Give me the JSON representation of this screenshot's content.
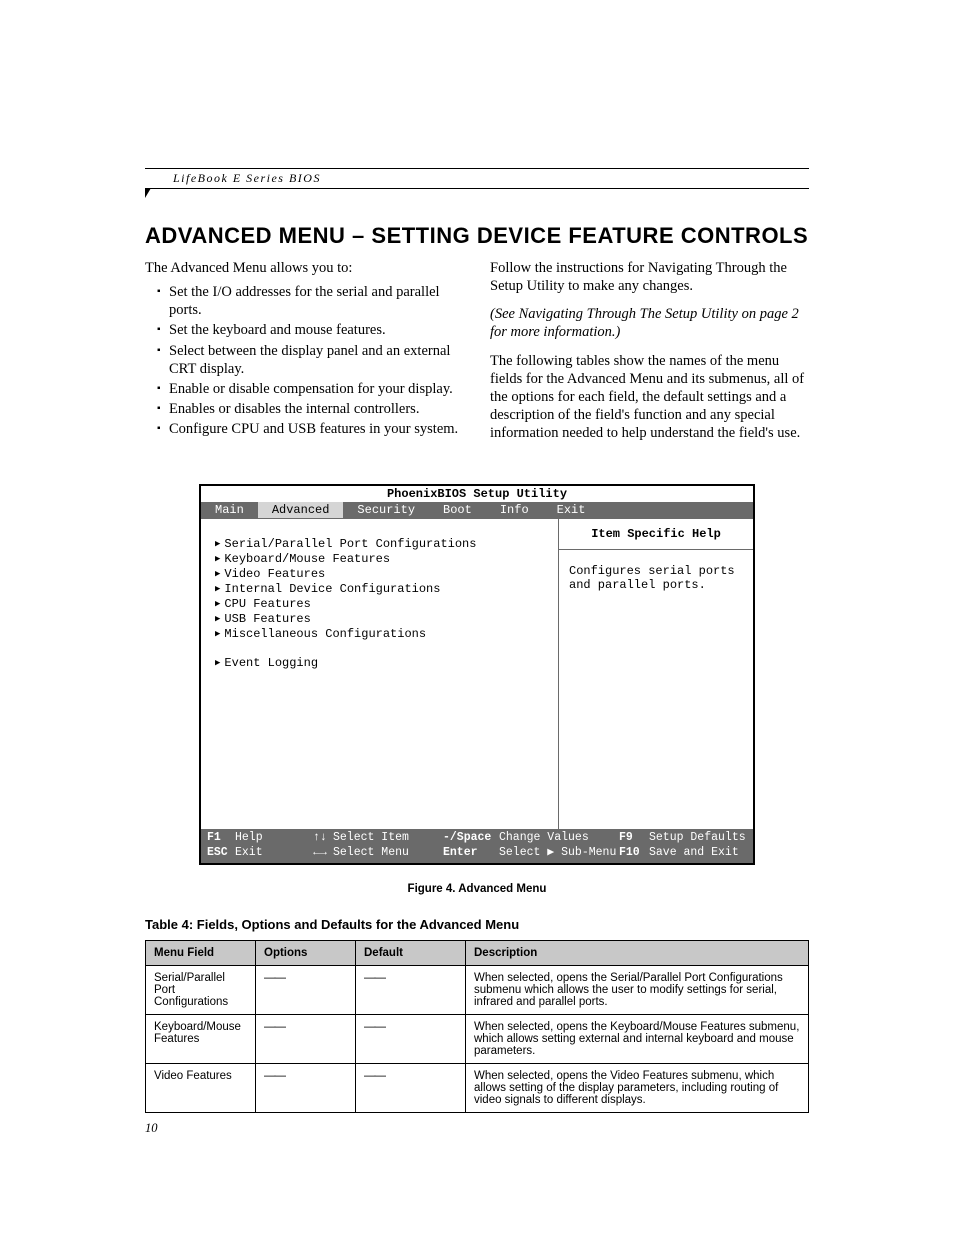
{
  "header": {
    "section_label": "LifeBook E Series BIOS"
  },
  "title": "ADVANCED MENU – SETTING DEVICE FEATURE CONTROLS",
  "left_col": {
    "intro": "The Advanced Menu allows you to:",
    "bullets": [
      "Set the I/O addresses for the serial and parallel ports.",
      "Set the keyboard and mouse features.",
      "Select between the display panel and an external CRT display.",
      "Enable or disable compensation for your display.",
      "Enables or disables the internal controllers.",
      "Configure CPU and USB features in your system."
    ]
  },
  "right_col": {
    "p1": "Follow the instructions for Navigating Through the Setup Utility to make any changes.",
    "p2": "(See Navigating Through The Setup Utility on page 2 for more information.)",
    "p3": "The following tables show the names of the menu fields for the Advanced Menu and its submenus, all of the options for each field, the default settings and a description of the field's function and any special information needed to help understand the field's use."
  },
  "bios": {
    "title": "PhoenixBIOS Setup Utility",
    "tabs": [
      "Main",
      "Advanced",
      "Security",
      "Boot",
      "Info",
      "Exit"
    ],
    "active_tab": "Advanced",
    "items": [
      "Serial/Parallel Port Configurations",
      "Keyboard/Mouse Features",
      "Video Features",
      "Internal Device Configurations",
      "CPU Features",
      "USB Features",
      "Miscellaneous Configurations"
    ],
    "items2": [
      "Event Logging"
    ],
    "help_title": "Item Specific Help",
    "help_text": "Configures serial ports and parallel ports.",
    "footer": {
      "f1": "F1",
      "help": "Help",
      "esc": "ESC",
      "exit": "Exit",
      "updown": "↑↓",
      "select_item": "Select Item",
      "leftright": "←→",
      "select_menu": "Select Menu",
      "minus": "-/Space",
      "change": "Change Values",
      "enter": "Enter",
      "sub": "Select ▶ Sub-Menu",
      "f9": "F9",
      "defaults": "Setup Defaults",
      "f10": "F10",
      "save": "Save and Exit"
    }
  },
  "fig_caption": "Figure 4.  Advanced Menu",
  "table_title": "Table 4: Fields, Options and Defaults for the Advanced Menu",
  "table": {
    "headers": [
      "Menu Field",
      "Options",
      "Default",
      "Description"
    ],
    "rows": [
      {
        "field": "Serial/Parallel Port Configurations",
        "options": "——",
        "default": "——",
        "desc": "When selected, opens the Serial/Parallel Port Configurations submenu which allows the user to modify settings for serial, infrared and parallel ports."
      },
      {
        "field": "Keyboard/Mouse Features",
        "options": "——",
        "default": "——",
        "desc": "When selected, opens the Keyboard/Mouse Features submenu, which allows setting external and internal keyboard and mouse parameters."
      },
      {
        "field": "Video Features",
        "options": "——",
        "default": "——",
        "desc": "When selected, opens the Video Features submenu, which allows setting of the display parameters, including routing of video signals to different displays."
      }
    ]
  },
  "page_number": "10"
}
